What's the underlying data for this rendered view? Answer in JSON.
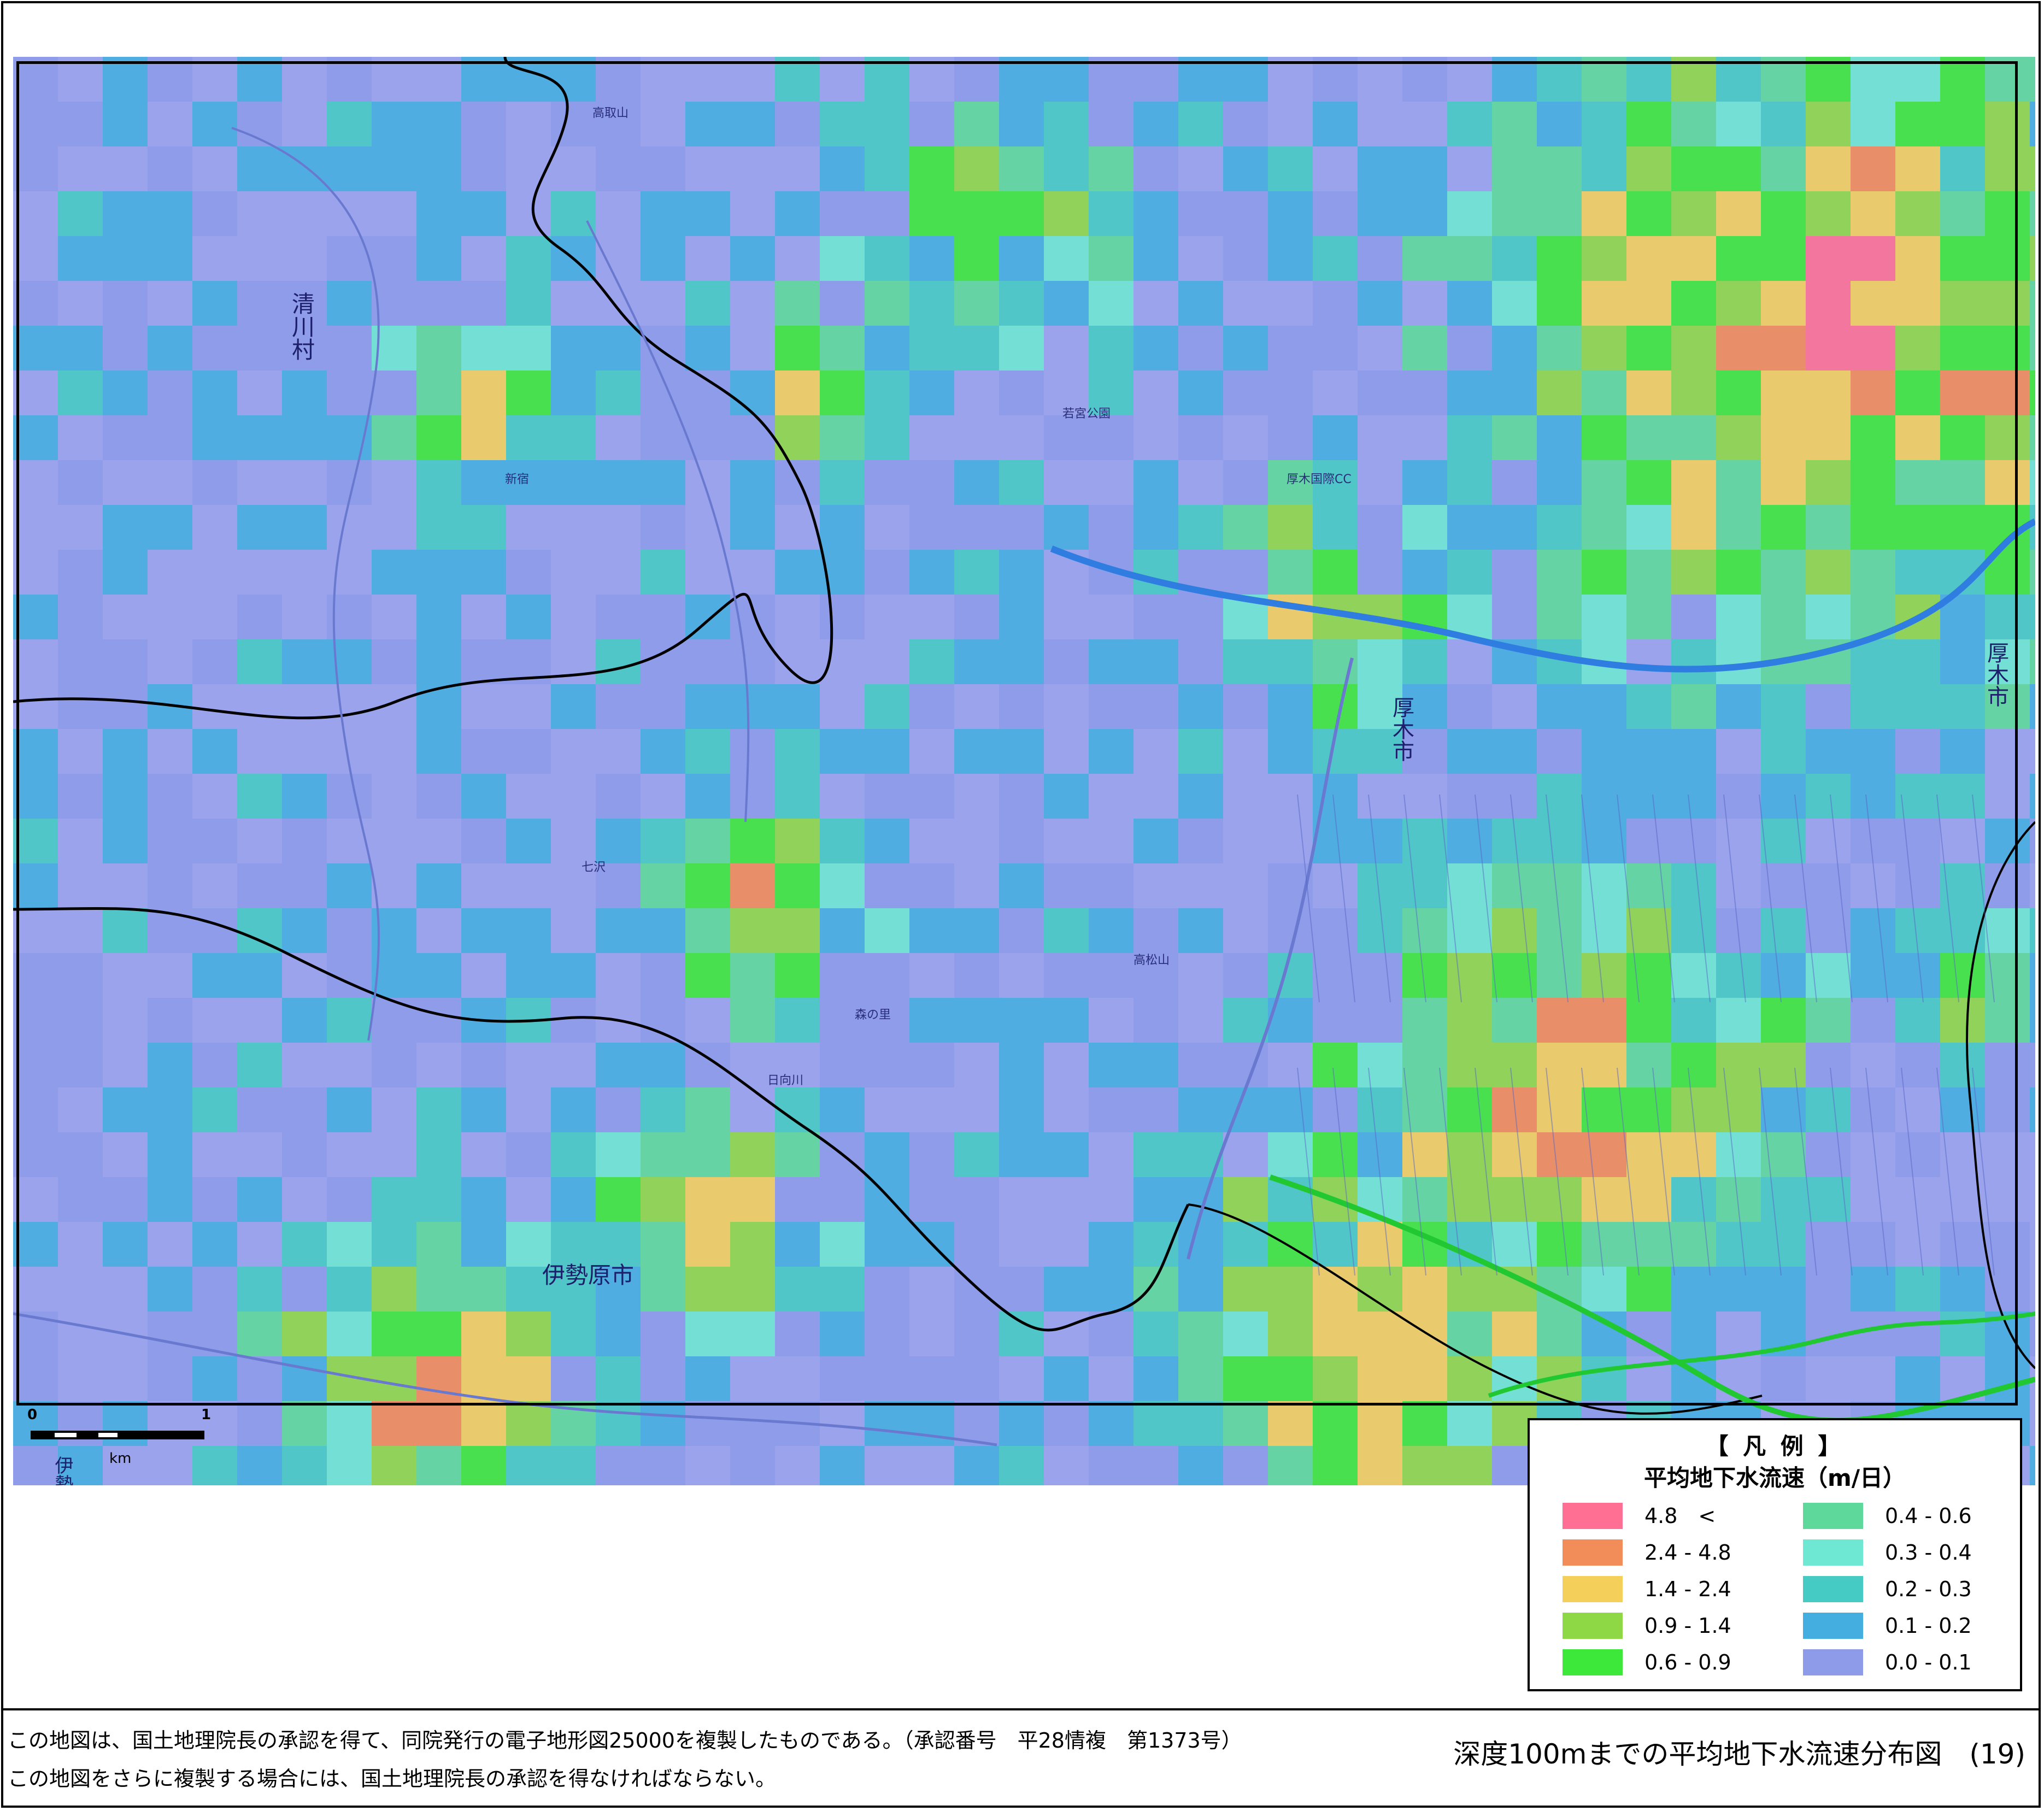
{
  "map": {
    "place_labels": [
      "清川村",
      "厚木市",
      "厚木市",
      "伊勢原市",
      "伊勢"
    ],
    "small_labels": [
      "高取山",
      "高松山",
      "厚木国際CC",
      "若宮公園",
      "七沢",
      "日向川",
      "森の里",
      "新宿"
    ],
    "scale": {
      "start": "0",
      "end": "1",
      "unit": "km"
    }
  },
  "legend": {
    "title": "【 凡 例 】",
    "subtitle": "平均地下水流速（m/日）",
    "items": [
      {
        "label": "4.8　<",
        "color": "#ff6f94"
      },
      {
        "label": "2.4 - 4.8",
        "color": "#f28c58"
      },
      {
        "label": "1.4 - 2.4",
        "color": "#f4cf5a"
      },
      {
        "label": "0.9 - 1.4",
        "color": "#8ed846"
      },
      {
        "label": "0.6 - 0.9",
        "color": "#3ee83a"
      },
      {
        "label": "0.4 - 0.6",
        "color": "#5fd99b"
      },
      {
        "label": "0.3 - 0.4",
        "color": "#6ee8d2"
      },
      {
        "label": "0.2 - 0.3",
        "color": "#46cbc4"
      },
      {
        "label": "0.1 - 0.2",
        "color": "#44aee0"
      },
      {
        "label": "0.0 - 0.1",
        "color": "#8d9be9"
      }
    ]
  },
  "footer": {
    "notice_line1": "この地図は、国土地理院長の承認を得て、同院発行の電子地形図25000を複製したものである。（承認番号　平28情複　第1373号）",
    "notice_line2": "この地図をさらに複製する場合には、国土地理院長の承認を得なければならない。",
    "sheet_title": "深度100mまでの平均地下水流速分布図　(19)"
  }
}
